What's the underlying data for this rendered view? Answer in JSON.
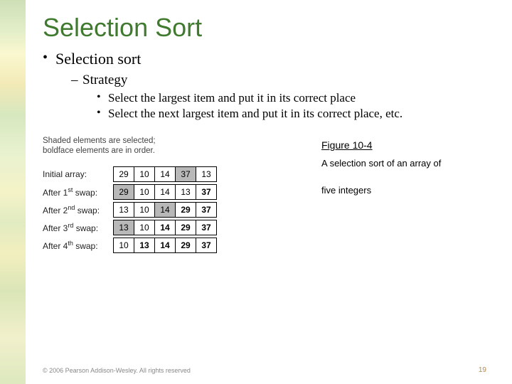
{
  "title": "Selection Sort",
  "bullets": {
    "l1": "Selection sort",
    "l2": "Strategy",
    "l3a": "Select the largest item and put it in its correct place",
    "l3b": "Select the next largest item and put it in its correct place, etc."
  },
  "figure": {
    "note_line1": "Shaded elements are selected;",
    "note_line2": "boldface elements are in order.",
    "label": "Figure 10-4",
    "caption_a": "A selection sort of an array of",
    "caption_b": "five integers",
    "row_labels": {
      "initial": "Initial array:",
      "s1_pre": "After 1",
      "s1_sup": "st",
      "s1_post": " swap:",
      "s2_pre": "After 2",
      "s2_sup": "nd",
      "s2_post": " swap:",
      "s3_pre": "After 3",
      "s3_sup": "rd",
      "s3_post": " swap:",
      "s4_pre": "After 4",
      "s4_sup": "th",
      "s4_post": " swap:"
    }
  },
  "chart_data": {
    "type": "table",
    "title": "Selection sort trace on five integers",
    "columns": 5,
    "rows": [
      {
        "label": "Initial array:",
        "values": [
          29,
          10,
          14,
          37,
          13
        ],
        "shaded_indices": [
          3
        ],
        "bold_indices": []
      },
      {
        "label": "After 1st swap:",
        "values": [
          29,
          10,
          14,
          13,
          37
        ],
        "shaded_indices": [
          0
        ],
        "bold_indices": [
          4
        ]
      },
      {
        "label": "After 2nd swap:",
        "values": [
          13,
          10,
          14,
          29,
          37
        ],
        "shaded_indices": [
          2
        ],
        "bold_indices": [
          3,
          4
        ]
      },
      {
        "label": "After 3rd swap:",
        "values": [
          13,
          10,
          14,
          29,
          37
        ],
        "shaded_indices": [
          0
        ],
        "bold_indices": [
          2,
          3,
          4
        ]
      },
      {
        "label": "After 4th swap:",
        "values": [
          10,
          13,
          14,
          29,
          37
        ],
        "shaded_indices": [],
        "bold_indices": [
          1,
          2,
          3,
          4
        ]
      }
    ]
  },
  "footer": "© 2006 Pearson Addison-Wesley. All rights reserved",
  "page": "19"
}
